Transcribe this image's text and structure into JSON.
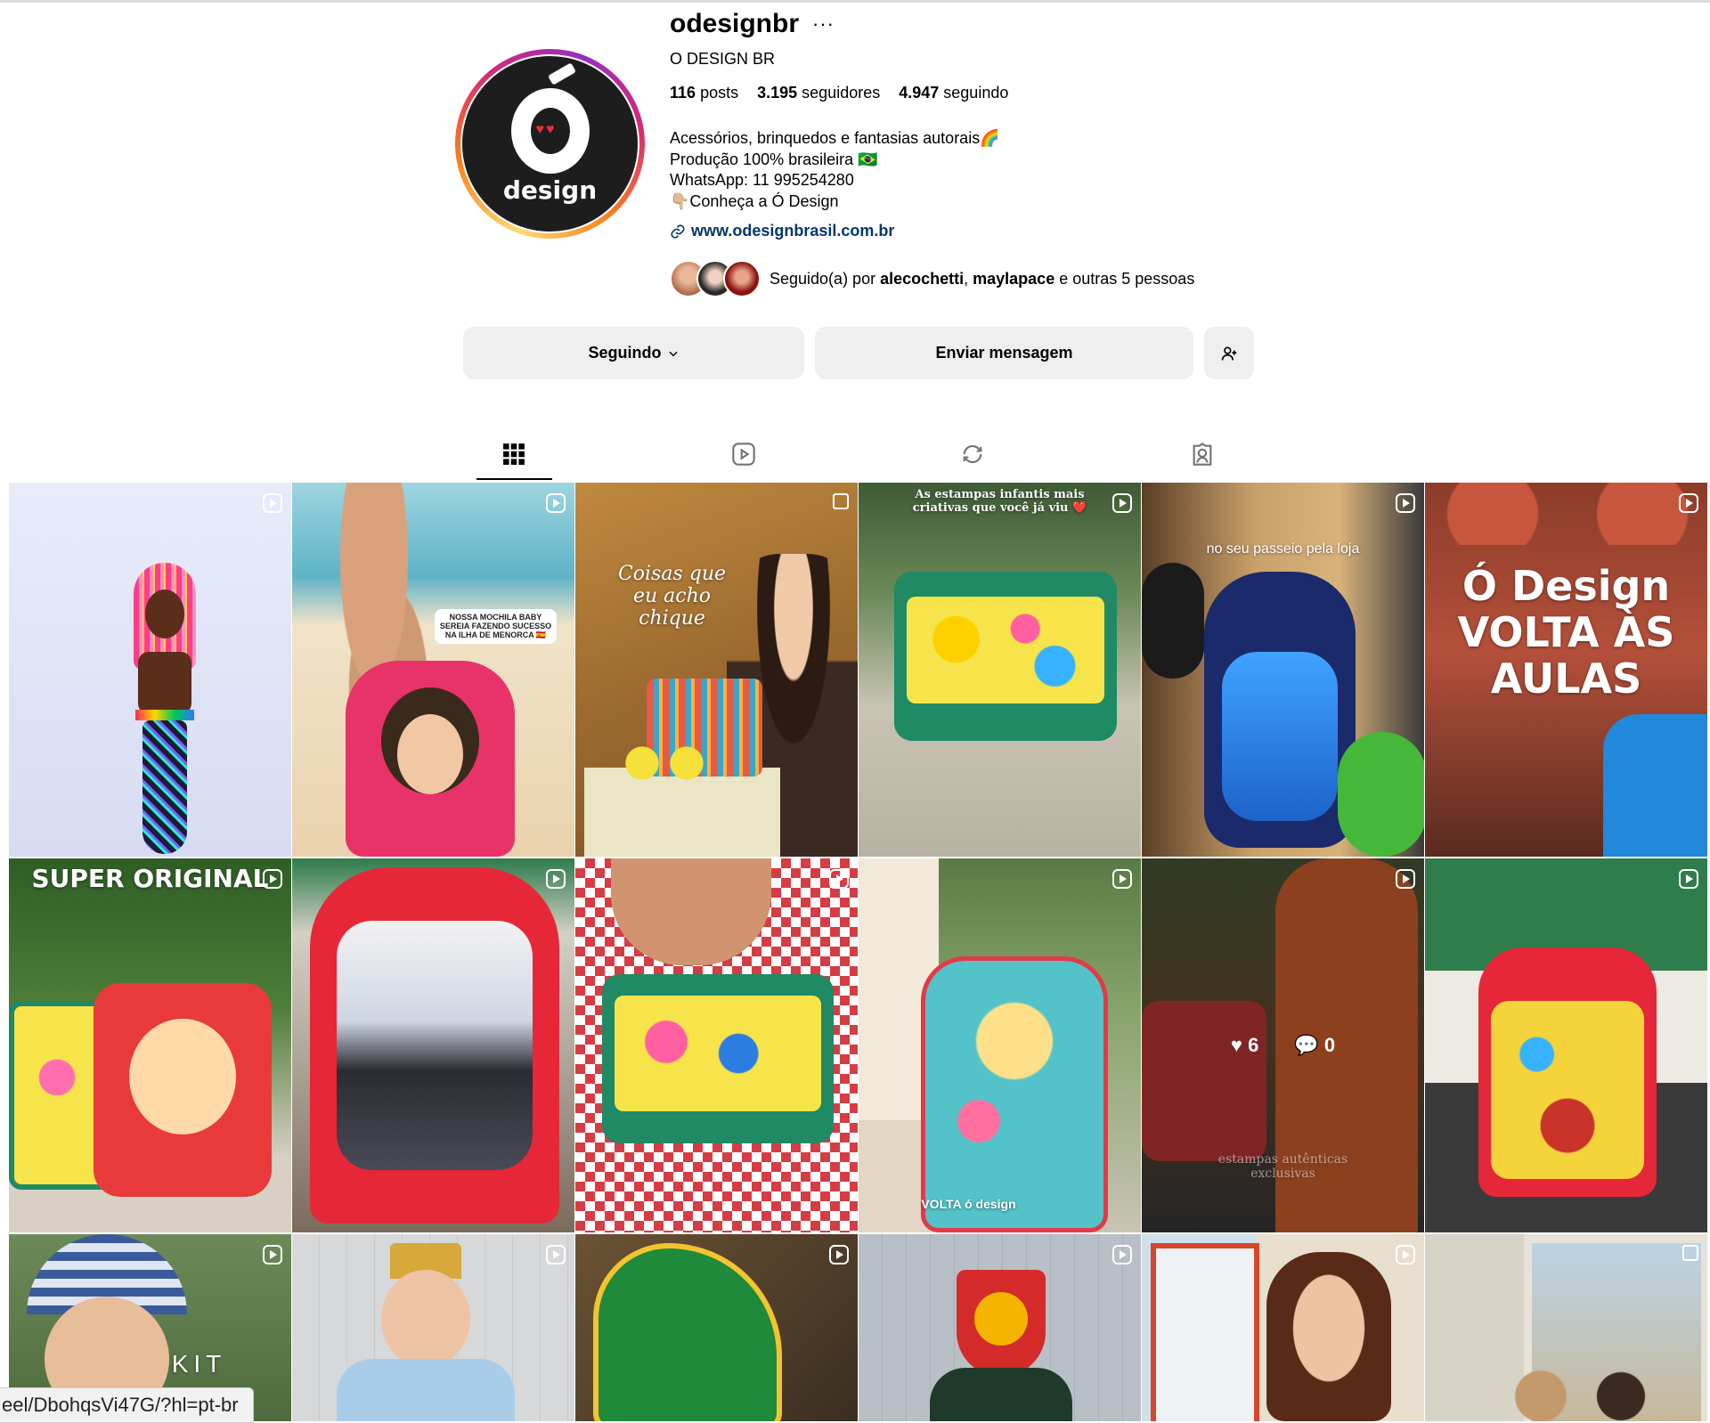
{
  "profile": {
    "username": "odesignbr",
    "more_label": "···",
    "full_name": "O DESIGN BR",
    "avatar_logo_text": "design",
    "stats": {
      "posts_count": "116",
      "posts_label": "posts",
      "followers_count": "3.195",
      "followers_label": "seguidores",
      "following_count": "4.947",
      "following_label": "seguindo"
    },
    "bio_lines": [
      "Acessórios, brinquedos e fantasias autorais🌈",
      "Produção 100% brasileira 🇧🇷",
      "WhatsApp: 11 995254280",
      "👇🏼Conheça a Ó Design"
    ],
    "website": "www.odesignbrasil.com.br",
    "followed_by": {
      "prefix": "Seguido(a) por ",
      "user1": "alecochetti",
      "separator": ", ",
      "user2": "maylapace",
      "suffix": " e outras 5 pessoas"
    }
  },
  "actions": {
    "following_label": "Seguindo",
    "message_label": "Enviar mensagem"
  },
  "tabs": [
    "posts-grid",
    "reels",
    "reposts",
    "tagged"
  ],
  "grid": {
    "tiles": [
      {
        "caption": "",
        "bg": "#dfe4f7",
        "icon": "reel"
      },
      {
        "caption": "NOSSA MOCHILA BABY SEREIA FAZENDO SUCESSO NA ILHA DE MENORCA 🇪🇸",
        "bg": "#e8c9a6",
        "icon": "reel"
      },
      {
        "caption": "Coisas que eu acho chique",
        "bg": "#b07a3c",
        "icon": "carousel"
      },
      {
        "caption": "As estampas infantis mais criativas que você já viu ❤️",
        "bg": "#5d7a52",
        "icon": "reel"
      },
      {
        "caption": "no seu passeio pela loja",
        "bg": "#b8955f",
        "icon": "reel"
      },
      {
        "caption": "Ó Design VOLTA ÀS AULAS",
        "bg": "#8b3a2b",
        "icon": "reel"
      },
      {
        "caption": "SUPER ORIGINAL",
        "bg": "#3d6b2f",
        "icon": "reel"
      },
      {
        "caption": "",
        "bg": "#e3333f",
        "icon": "reel"
      },
      {
        "caption": "",
        "bg": "#c9353d",
        "icon": "reel"
      },
      {
        "caption": "VOLTA ó design",
        "bg": "#6e8c5a",
        "icon": "reel"
      },
      {
        "caption": "estampas autênticas exclusivas",
        "bg": "#6b4a2e",
        "icon": "reel",
        "likes": "6",
        "comments": "0"
      },
      {
        "caption": "",
        "bg": "#2e7d4a",
        "icon": "reel"
      },
      {
        "caption": "KIT",
        "bg": "#5a7a45",
        "icon": "reel"
      },
      {
        "caption": "",
        "bg": "#cfd3d6",
        "icon": "reel"
      },
      {
        "caption": "",
        "bg": "#4a3c2e",
        "icon": "reel"
      },
      {
        "caption": "",
        "bg": "#b9bfc6",
        "icon": "reel"
      },
      {
        "caption": "",
        "bg": "#e9dfcf",
        "icon": "reel"
      },
      {
        "caption": "",
        "bg": "#d8d3c7",
        "icon": "carousel"
      }
    ]
  },
  "status_bar_url": "eel/DbohqsVi47G/?hl=pt-br",
  "colors": {
    "link": "#00376b",
    "button_bg": "#efefef"
  }
}
